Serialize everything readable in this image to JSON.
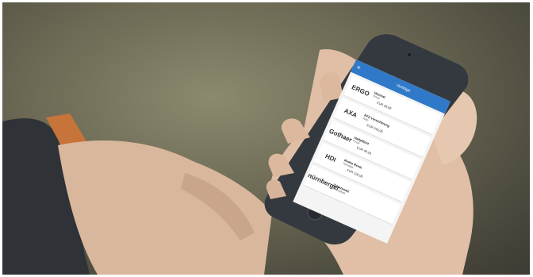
{
  "app": {
    "title": "Verträge",
    "menu_icon": "menu-icon",
    "contracts": [
      {
        "logo_text": "ERGO",
        "name": "Hausrat",
        "type": "Privat",
        "price": "EUR 28,90"
      },
      {
        "logo_text": "AXA",
        "name": "KFZ-Versicherung",
        "type": "Auto",
        "price": "EUR 245,00"
      },
      {
        "logo_text": "Gothaer",
        "name": "Haftpflicht",
        "type": "Privat",
        "price": "EUR 48,20"
      },
      {
        "logo_text": "HDI",
        "name": "Risiko Rente",
        "type": "Vorsorge",
        "price": "EUR 126,00"
      },
      {
        "logo_text": "nürnberger",
        "name": "Zahnzusatz",
        "type": "Gesundheit",
        "price": ""
      }
    ]
  }
}
